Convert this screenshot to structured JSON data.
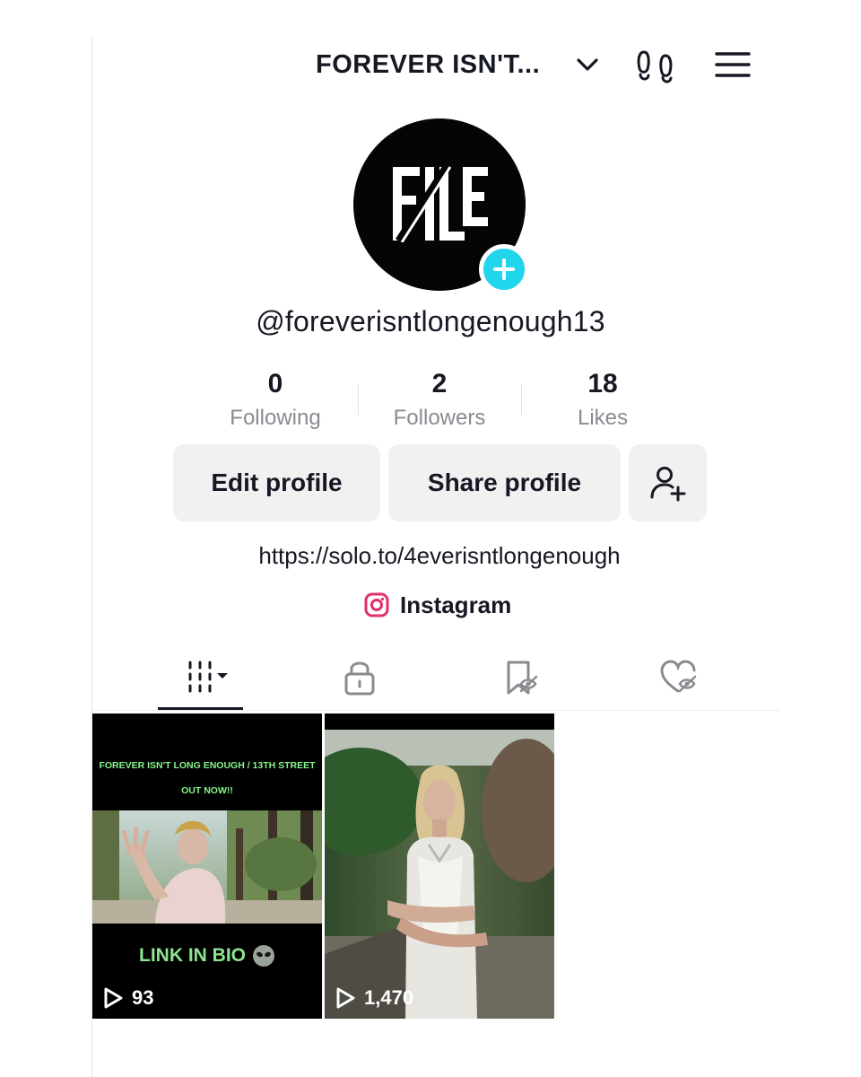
{
  "header": {
    "title": "FOREVER ISN'T...",
    "icons": [
      "chevron-down-icon",
      "footprints-icon",
      "menu-icon"
    ]
  },
  "profile": {
    "avatar_logo_text": "FILE",
    "username": "@foreverisntlongenough13",
    "stats": [
      {
        "value": "0",
        "label": "Following"
      },
      {
        "value": "2",
        "label": "Followers"
      },
      {
        "value": "18",
        "label": "Likes"
      }
    ],
    "buttons": {
      "edit": "Edit profile",
      "share": "Share profile"
    },
    "bio_link": "https://solo.to/4everisntlongenough",
    "instagram_label": "Instagram"
  },
  "tabs": [
    {
      "icon": "videos-grid-icon",
      "selected": true
    },
    {
      "icon": "lock-icon",
      "selected": false
    },
    {
      "icon": "bookmark-hidden-icon",
      "selected": false
    },
    {
      "icon": "liked-hidden-icon",
      "selected": false
    }
  ],
  "videos": [
    {
      "caption_line1": "FOREVER ISN'T LONG ENOUGH / 13TH STREET",
      "caption_line2": "OUT NOW!!",
      "caption_bottom": "LINK IN BIO",
      "views": "93"
    },
    {
      "views": "1,470"
    }
  ],
  "colors": {
    "accent_add": "#20d5ec",
    "button_bg": "#f1f1f2",
    "muted_text": "#8a8b91",
    "caption_green": "#86f58a",
    "instagram_pink": "#e1306c"
  }
}
